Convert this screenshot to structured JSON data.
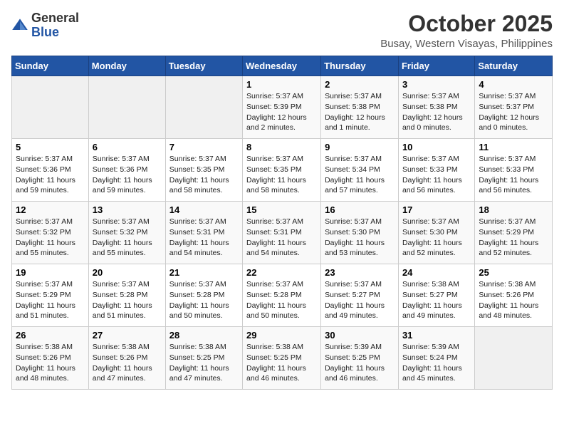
{
  "logo": {
    "general": "General",
    "blue": "Blue"
  },
  "title": "October 2025",
  "subtitle": "Busay, Western Visayas, Philippines",
  "days_of_week": [
    "Sunday",
    "Monday",
    "Tuesday",
    "Wednesday",
    "Thursday",
    "Friday",
    "Saturday"
  ],
  "weeks": [
    [
      {
        "day": "",
        "info": ""
      },
      {
        "day": "",
        "info": ""
      },
      {
        "day": "",
        "info": ""
      },
      {
        "day": "1",
        "info": "Sunrise: 5:37 AM\nSunset: 5:39 PM\nDaylight: 12 hours and 2 minutes."
      },
      {
        "day": "2",
        "info": "Sunrise: 5:37 AM\nSunset: 5:38 PM\nDaylight: 12 hours and 1 minute."
      },
      {
        "day": "3",
        "info": "Sunrise: 5:37 AM\nSunset: 5:38 PM\nDaylight: 12 hours and 0 minutes."
      },
      {
        "day": "4",
        "info": "Sunrise: 5:37 AM\nSunset: 5:37 PM\nDaylight: 12 hours and 0 minutes."
      }
    ],
    [
      {
        "day": "5",
        "info": "Sunrise: 5:37 AM\nSunset: 5:36 PM\nDaylight: 11 hours and 59 minutes."
      },
      {
        "day": "6",
        "info": "Sunrise: 5:37 AM\nSunset: 5:36 PM\nDaylight: 11 hours and 59 minutes."
      },
      {
        "day": "7",
        "info": "Sunrise: 5:37 AM\nSunset: 5:35 PM\nDaylight: 11 hours and 58 minutes."
      },
      {
        "day": "8",
        "info": "Sunrise: 5:37 AM\nSunset: 5:35 PM\nDaylight: 11 hours and 58 minutes."
      },
      {
        "day": "9",
        "info": "Sunrise: 5:37 AM\nSunset: 5:34 PM\nDaylight: 11 hours and 57 minutes."
      },
      {
        "day": "10",
        "info": "Sunrise: 5:37 AM\nSunset: 5:33 PM\nDaylight: 11 hours and 56 minutes."
      },
      {
        "day": "11",
        "info": "Sunrise: 5:37 AM\nSunset: 5:33 PM\nDaylight: 11 hours and 56 minutes."
      }
    ],
    [
      {
        "day": "12",
        "info": "Sunrise: 5:37 AM\nSunset: 5:32 PM\nDaylight: 11 hours and 55 minutes."
      },
      {
        "day": "13",
        "info": "Sunrise: 5:37 AM\nSunset: 5:32 PM\nDaylight: 11 hours and 55 minutes."
      },
      {
        "day": "14",
        "info": "Sunrise: 5:37 AM\nSunset: 5:31 PM\nDaylight: 11 hours and 54 minutes."
      },
      {
        "day": "15",
        "info": "Sunrise: 5:37 AM\nSunset: 5:31 PM\nDaylight: 11 hours and 54 minutes."
      },
      {
        "day": "16",
        "info": "Sunrise: 5:37 AM\nSunset: 5:30 PM\nDaylight: 11 hours and 53 minutes."
      },
      {
        "day": "17",
        "info": "Sunrise: 5:37 AM\nSunset: 5:30 PM\nDaylight: 11 hours and 52 minutes."
      },
      {
        "day": "18",
        "info": "Sunrise: 5:37 AM\nSunset: 5:29 PM\nDaylight: 11 hours and 52 minutes."
      }
    ],
    [
      {
        "day": "19",
        "info": "Sunrise: 5:37 AM\nSunset: 5:29 PM\nDaylight: 11 hours and 51 minutes."
      },
      {
        "day": "20",
        "info": "Sunrise: 5:37 AM\nSunset: 5:28 PM\nDaylight: 11 hours and 51 minutes."
      },
      {
        "day": "21",
        "info": "Sunrise: 5:37 AM\nSunset: 5:28 PM\nDaylight: 11 hours and 50 minutes."
      },
      {
        "day": "22",
        "info": "Sunrise: 5:37 AM\nSunset: 5:28 PM\nDaylight: 11 hours and 50 minutes."
      },
      {
        "day": "23",
        "info": "Sunrise: 5:37 AM\nSunset: 5:27 PM\nDaylight: 11 hours and 49 minutes."
      },
      {
        "day": "24",
        "info": "Sunrise: 5:38 AM\nSunset: 5:27 PM\nDaylight: 11 hours and 49 minutes."
      },
      {
        "day": "25",
        "info": "Sunrise: 5:38 AM\nSunset: 5:26 PM\nDaylight: 11 hours and 48 minutes."
      }
    ],
    [
      {
        "day": "26",
        "info": "Sunrise: 5:38 AM\nSunset: 5:26 PM\nDaylight: 11 hours and 48 minutes."
      },
      {
        "day": "27",
        "info": "Sunrise: 5:38 AM\nSunset: 5:26 PM\nDaylight: 11 hours and 47 minutes."
      },
      {
        "day": "28",
        "info": "Sunrise: 5:38 AM\nSunset: 5:25 PM\nDaylight: 11 hours and 47 minutes."
      },
      {
        "day": "29",
        "info": "Sunrise: 5:38 AM\nSunset: 5:25 PM\nDaylight: 11 hours and 46 minutes."
      },
      {
        "day": "30",
        "info": "Sunrise: 5:39 AM\nSunset: 5:25 PM\nDaylight: 11 hours and 46 minutes."
      },
      {
        "day": "31",
        "info": "Sunrise: 5:39 AM\nSunset: 5:24 PM\nDaylight: 11 hours and 45 minutes."
      },
      {
        "day": "",
        "info": ""
      }
    ]
  ]
}
